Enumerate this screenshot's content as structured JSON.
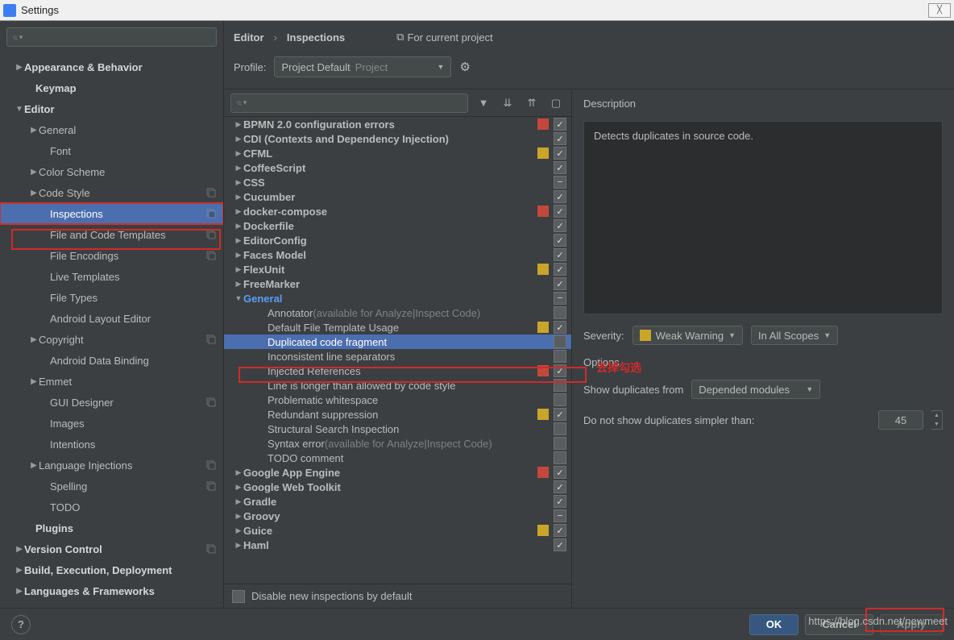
{
  "window_title": "Settings",
  "breadcrumb": {
    "a": "Editor",
    "sep": "›",
    "b": "Inspections",
    "link": "For current project"
  },
  "profile": {
    "label": "Profile:",
    "value": "Project Default",
    "scope": "Project"
  },
  "sidebar": [
    {
      "label": "Appearance & Behavior",
      "indent": 18,
      "arrow": "closed",
      "bold": true
    },
    {
      "label": "Keymap",
      "indent": 32,
      "bold": true
    },
    {
      "label": "Editor",
      "indent": 18,
      "arrow": "open",
      "bold": true
    },
    {
      "label": "General",
      "indent": 36,
      "arrow": "closed"
    },
    {
      "label": "Font",
      "indent": 50
    },
    {
      "label": "Color Scheme",
      "indent": 36,
      "arrow": "closed"
    },
    {
      "label": "Code Style",
      "indent": 36,
      "arrow": "closed",
      "copy": true
    },
    {
      "label": "Inspections",
      "indent": 50,
      "copy": true,
      "selected": true,
      "highlight": true
    },
    {
      "label": "File and Code Templates",
      "indent": 50,
      "copy": true
    },
    {
      "label": "File Encodings",
      "indent": 50,
      "copy": true
    },
    {
      "label": "Live Templates",
      "indent": 50
    },
    {
      "label": "File Types",
      "indent": 50
    },
    {
      "label": "Android Layout Editor",
      "indent": 50
    },
    {
      "label": "Copyright",
      "indent": 36,
      "arrow": "closed",
      "copy": true
    },
    {
      "label": "Android Data Binding",
      "indent": 50
    },
    {
      "label": "Emmet",
      "indent": 36,
      "arrow": "closed"
    },
    {
      "label": "GUI Designer",
      "indent": 50,
      "copy": true
    },
    {
      "label": "Images",
      "indent": 50
    },
    {
      "label": "Intentions",
      "indent": 50
    },
    {
      "label": "Language Injections",
      "indent": 36,
      "arrow": "closed",
      "copy": true
    },
    {
      "label": "Spelling",
      "indent": 50,
      "copy": true
    },
    {
      "label": "TODO",
      "indent": 50
    },
    {
      "label": "Plugins",
      "indent": 32,
      "bold": true
    },
    {
      "label": "Version Control",
      "indent": 18,
      "arrow": "closed",
      "bold": true,
      "copy": true
    },
    {
      "label": "Build, Execution, Deployment",
      "indent": 18,
      "arrow": "closed",
      "bold": true
    },
    {
      "label": "Languages & Frameworks",
      "indent": 18,
      "arrow": "closed",
      "bold": true
    }
  ],
  "inspections": [
    {
      "label": "BPMN 2.0 configuration errors",
      "indent": 6,
      "arrow": "c",
      "bold": true,
      "sev": "red",
      "chk": "on"
    },
    {
      "label": "CDI (Contexts and Dependency Injection)",
      "indent": 6,
      "arrow": "c",
      "bold": true,
      "chk": "on"
    },
    {
      "label": "CFML",
      "indent": 6,
      "arrow": "c",
      "bold": true,
      "sev": "yellow",
      "chk": "on"
    },
    {
      "label": "CoffeeScript",
      "indent": 6,
      "arrow": "c",
      "bold": true,
      "chk": "on"
    },
    {
      "label": "CSS",
      "indent": 6,
      "arrow": "c",
      "bold": true,
      "chk": "mixed"
    },
    {
      "label": "Cucumber",
      "indent": 6,
      "arrow": "c",
      "bold": true,
      "chk": "on"
    },
    {
      "label": "docker-compose",
      "indent": 6,
      "arrow": "c",
      "bold": true,
      "sev": "red",
      "chk": "on"
    },
    {
      "label": "Dockerfile",
      "indent": 6,
      "arrow": "c",
      "bold": true,
      "chk": "on"
    },
    {
      "label": "EditorConfig",
      "indent": 6,
      "arrow": "c",
      "bold": true,
      "chk": "on"
    },
    {
      "label": "Faces Model",
      "indent": 6,
      "arrow": "c",
      "bold": true,
      "chk": "on"
    },
    {
      "label": "FlexUnit",
      "indent": 6,
      "arrow": "c",
      "bold": true,
      "sev": "yellow",
      "chk": "on"
    },
    {
      "label": "FreeMarker",
      "indent": 6,
      "arrow": "c",
      "bold": true,
      "chk": "on"
    },
    {
      "label": "General",
      "indent": 6,
      "arrow": "o",
      "bold": true,
      "link": true,
      "chk": "mixed"
    },
    {
      "label": "Annotator",
      "gray": " (available for Analyze|Inspect Code)",
      "indent": 36,
      "chk": "off"
    },
    {
      "label": "Default File Template Usage",
      "indent": 36,
      "sev": "yellow",
      "chk": "on"
    },
    {
      "label": "Duplicated code fragment",
      "indent": 36,
      "selected": true,
      "chk": "off",
      "highlight": true
    },
    {
      "label": "Inconsistent line separators",
      "indent": 36,
      "chk": "off"
    },
    {
      "label": "Injected References",
      "indent": 36,
      "sev": "red",
      "chk": "on"
    },
    {
      "label": "Line is longer than allowed by code style",
      "indent": 36,
      "chk": "off"
    },
    {
      "label": "Problematic whitespace",
      "indent": 36,
      "chk": "off"
    },
    {
      "label": "Redundant suppression",
      "indent": 36,
      "sev": "yellow",
      "chk": "on"
    },
    {
      "label": "Structural Search Inspection",
      "indent": 36,
      "chk": "off"
    },
    {
      "label": "Syntax error",
      "gray": " (available for Analyze|Inspect Code)",
      "indent": 36,
      "chk": "off"
    },
    {
      "label": "TODO comment",
      "indent": 36,
      "chk": "off"
    },
    {
      "label": "Google App Engine",
      "indent": 6,
      "arrow": "c",
      "bold": true,
      "sev": "red",
      "chk": "on"
    },
    {
      "label": "Google Web Toolkit",
      "indent": 6,
      "arrow": "c",
      "bold": true,
      "chk": "on"
    },
    {
      "label": "Gradle",
      "indent": 6,
      "arrow": "c",
      "bold": true,
      "chk": "on"
    },
    {
      "label": "Groovy",
      "indent": 6,
      "arrow": "c",
      "bold": true,
      "chk": "mixed"
    },
    {
      "label": "Guice",
      "indent": 6,
      "arrow": "c",
      "bold": true,
      "sev": "yellow",
      "chk": "on"
    },
    {
      "label": "Haml",
      "indent": 6,
      "arrow": "c",
      "bold": true,
      "chk": "on"
    }
  ],
  "disable_label": "Disable new inspections by default",
  "desc": {
    "heading": "Description",
    "text": "Detects duplicates in source code."
  },
  "severity": {
    "label": "Severity:",
    "value": "Weak Warning",
    "scope": "In All Scopes"
  },
  "options": {
    "heading": "Options",
    "show_from": "Show duplicates from",
    "show_from_value": "Depended modules",
    "simpler": "Do not show duplicates simpler than:",
    "simpler_value": "45"
  },
  "buttons": {
    "ok": "OK",
    "cancel": "Cancel",
    "apply": "Apply"
  },
  "annotation": "去掉勾选",
  "watermark": "https://blog.csdn.net/newmeet"
}
